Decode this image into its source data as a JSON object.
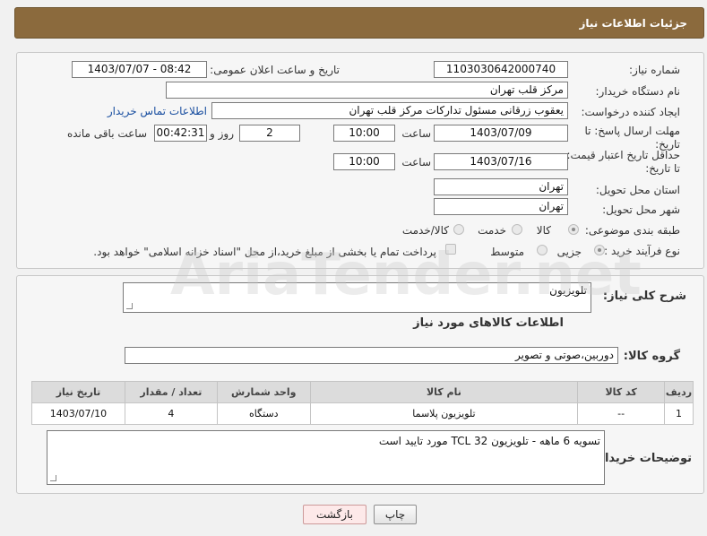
{
  "header": {
    "title": "جزئیات اطلاعات نیاز"
  },
  "form": {
    "need_number": {
      "label": "شماره نیاز:",
      "value": "1103030642000740"
    },
    "announce": {
      "label": "تاریخ و ساعت اعلان عمومی:",
      "value": "1403/07/07 - 08:42"
    },
    "buyer_org": {
      "label": "نام دستگاه خریدار:",
      "value": "مرکز قلب تهران"
    },
    "creator": {
      "label": "ایجاد کننده درخواست:",
      "value": "یعقوب زرقانی مسئول تدارکات مرکز قلب تهران",
      "contact_link": "اطلاعات تماس خریدار"
    },
    "reply_deadline": {
      "label": "مهلت ارسال پاسخ: تا تاریخ:",
      "date": "1403/07/09",
      "time_label": "ساعت",
      "time": "10:00",
      "days": "2",
      "days_label": "روز و",
      "remaining": "00:42:31",
      "remaining_label": "ساعت باقی مانده"
    },
    "price_validity": {
      "label": "حداقل تاریخ اعتبار قیمت: تا تاریخ:",
      "date": "1403/07/16",
      "time_label": "ساعت",
      "time": "10:00"
    },
    "province": {
      "label": "استان محل تحویل:",
      "value": "تهران"
    },
    "city": {
      "label": "شهر محل تحویل:",
      "value": "تهران"
    },
    "category": {
      "label": "طبقه بندی موضوعی:",
      "options": [
        "کالا",
        "خدمت",
        "کالا/خدمت"
      ]
    },
    "process": {
      "label": "نوع فرآیند خرید :",
      "options": [
        "جزیی",
        "متوسط"
      ],
      "note": "پرداخت تمام یا بخشی از مبلغ خرید،از محل \"اسناد خزانه اسلامی\" خواهد بود."
    }
  },
  "details": {
    "summary_label": "شرح کلی نیاز:",
    "summary_value": "تلویزیون",
    "goods_info_title": "اطلاعات کالاهای مورد نیاز",
    "group_label": "گروه کالا:",
    "group_value": "دوربین،صوتی و تصویر",
    "table": {
      "headers": [
        "ردیف",
        "کد کالا",
        "نام کالا",
        "واحد شمارش",
        "تعداد / مقدار",
        "تاریخ نیاز"
      ],
      "rows": [
        [
          "1",
          "--",
          "تلویزیون پلاسما",
          "دستگاه",
          "4",
          "1403/07/10"
        ]
      ]
    },
    "buyer_notes_label": "توضیحات خریدار:",
    "buyer_notes_value": "تسویه 6 ماهه - تلویزیون TCL 32 مورد تایید است"
  },
  "buttons": {
    "print": "چاپ",
    "back": "بازگشت"
  },
  "watermark": "AriaTender.net"
}
